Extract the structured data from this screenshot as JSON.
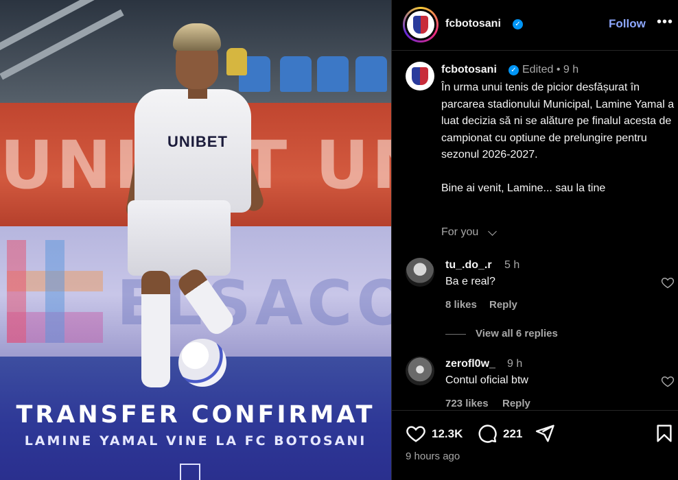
{
  "media": {
    "banner_text": "UNIBET UNI",
    "board_text": "ELSACO",
    "shirt_sponsor": "UNIBET",
    "caption_title": "TRANSFER CONFIRMAT",
    "caption_subtitle": "LAMINE YAMAL VINE LA FC BOTOSANI"
  },
  "header": {
    "username": "fcbotosani",
    "follow_label": "Follow",
    "more_label": "•••",
    "verified": true
  },
  "post": {
    "username": "fcbotosani",
    "edited_label": "Edited",
    "time": "9 h",
    "caption_lines": [
      "În urma unui tenis de picior desfășurat în parcarea stadionului Municipal, Lamine Yamal a luat decizia să ni se alăture pe finalul acesta de campionat cu optiune de prelungire pentru sezonul 2026-2027.",
      "Bine ai venit, Lamine... sau la tine"
    ],
    "for_you_label": "For you"
  },
  "comments": [
    {
      "username": "tu_.do_.r",
      "time": "5 h",
      "text": "Ba e real?",
      "likes": "8 likes",
      "reply_label": "Reply"
    },
    {
      "username": "zerofl0w_",
      "time": "9 h",
      "text": "Contul oficial btw",
      "likes": "723 likes",
      "reply_label": "Reply"
    }
  ],
  "view_replies_label": "View all 6 replies",
  "actions": {
    "like_count": "12.3K",
    "comment_count": "221",
    "time_ago": "9 hours ago"
  },
  "colors": {
    "background": "#000000",
    "text_primary": "#f5f5f5",
    "text_secondary": "#a8a8a8",
    "follow": "#8ea8ff",
    "verified": "#0095f6"
  },
  "icons": [
    "verified-badge-icon",
    "more-options-icon",
    "chevron-down-icon",
    "heart-icon",
    "comment-icon",
    "share-icon",
    "bookmark-icon"
  ]
}
